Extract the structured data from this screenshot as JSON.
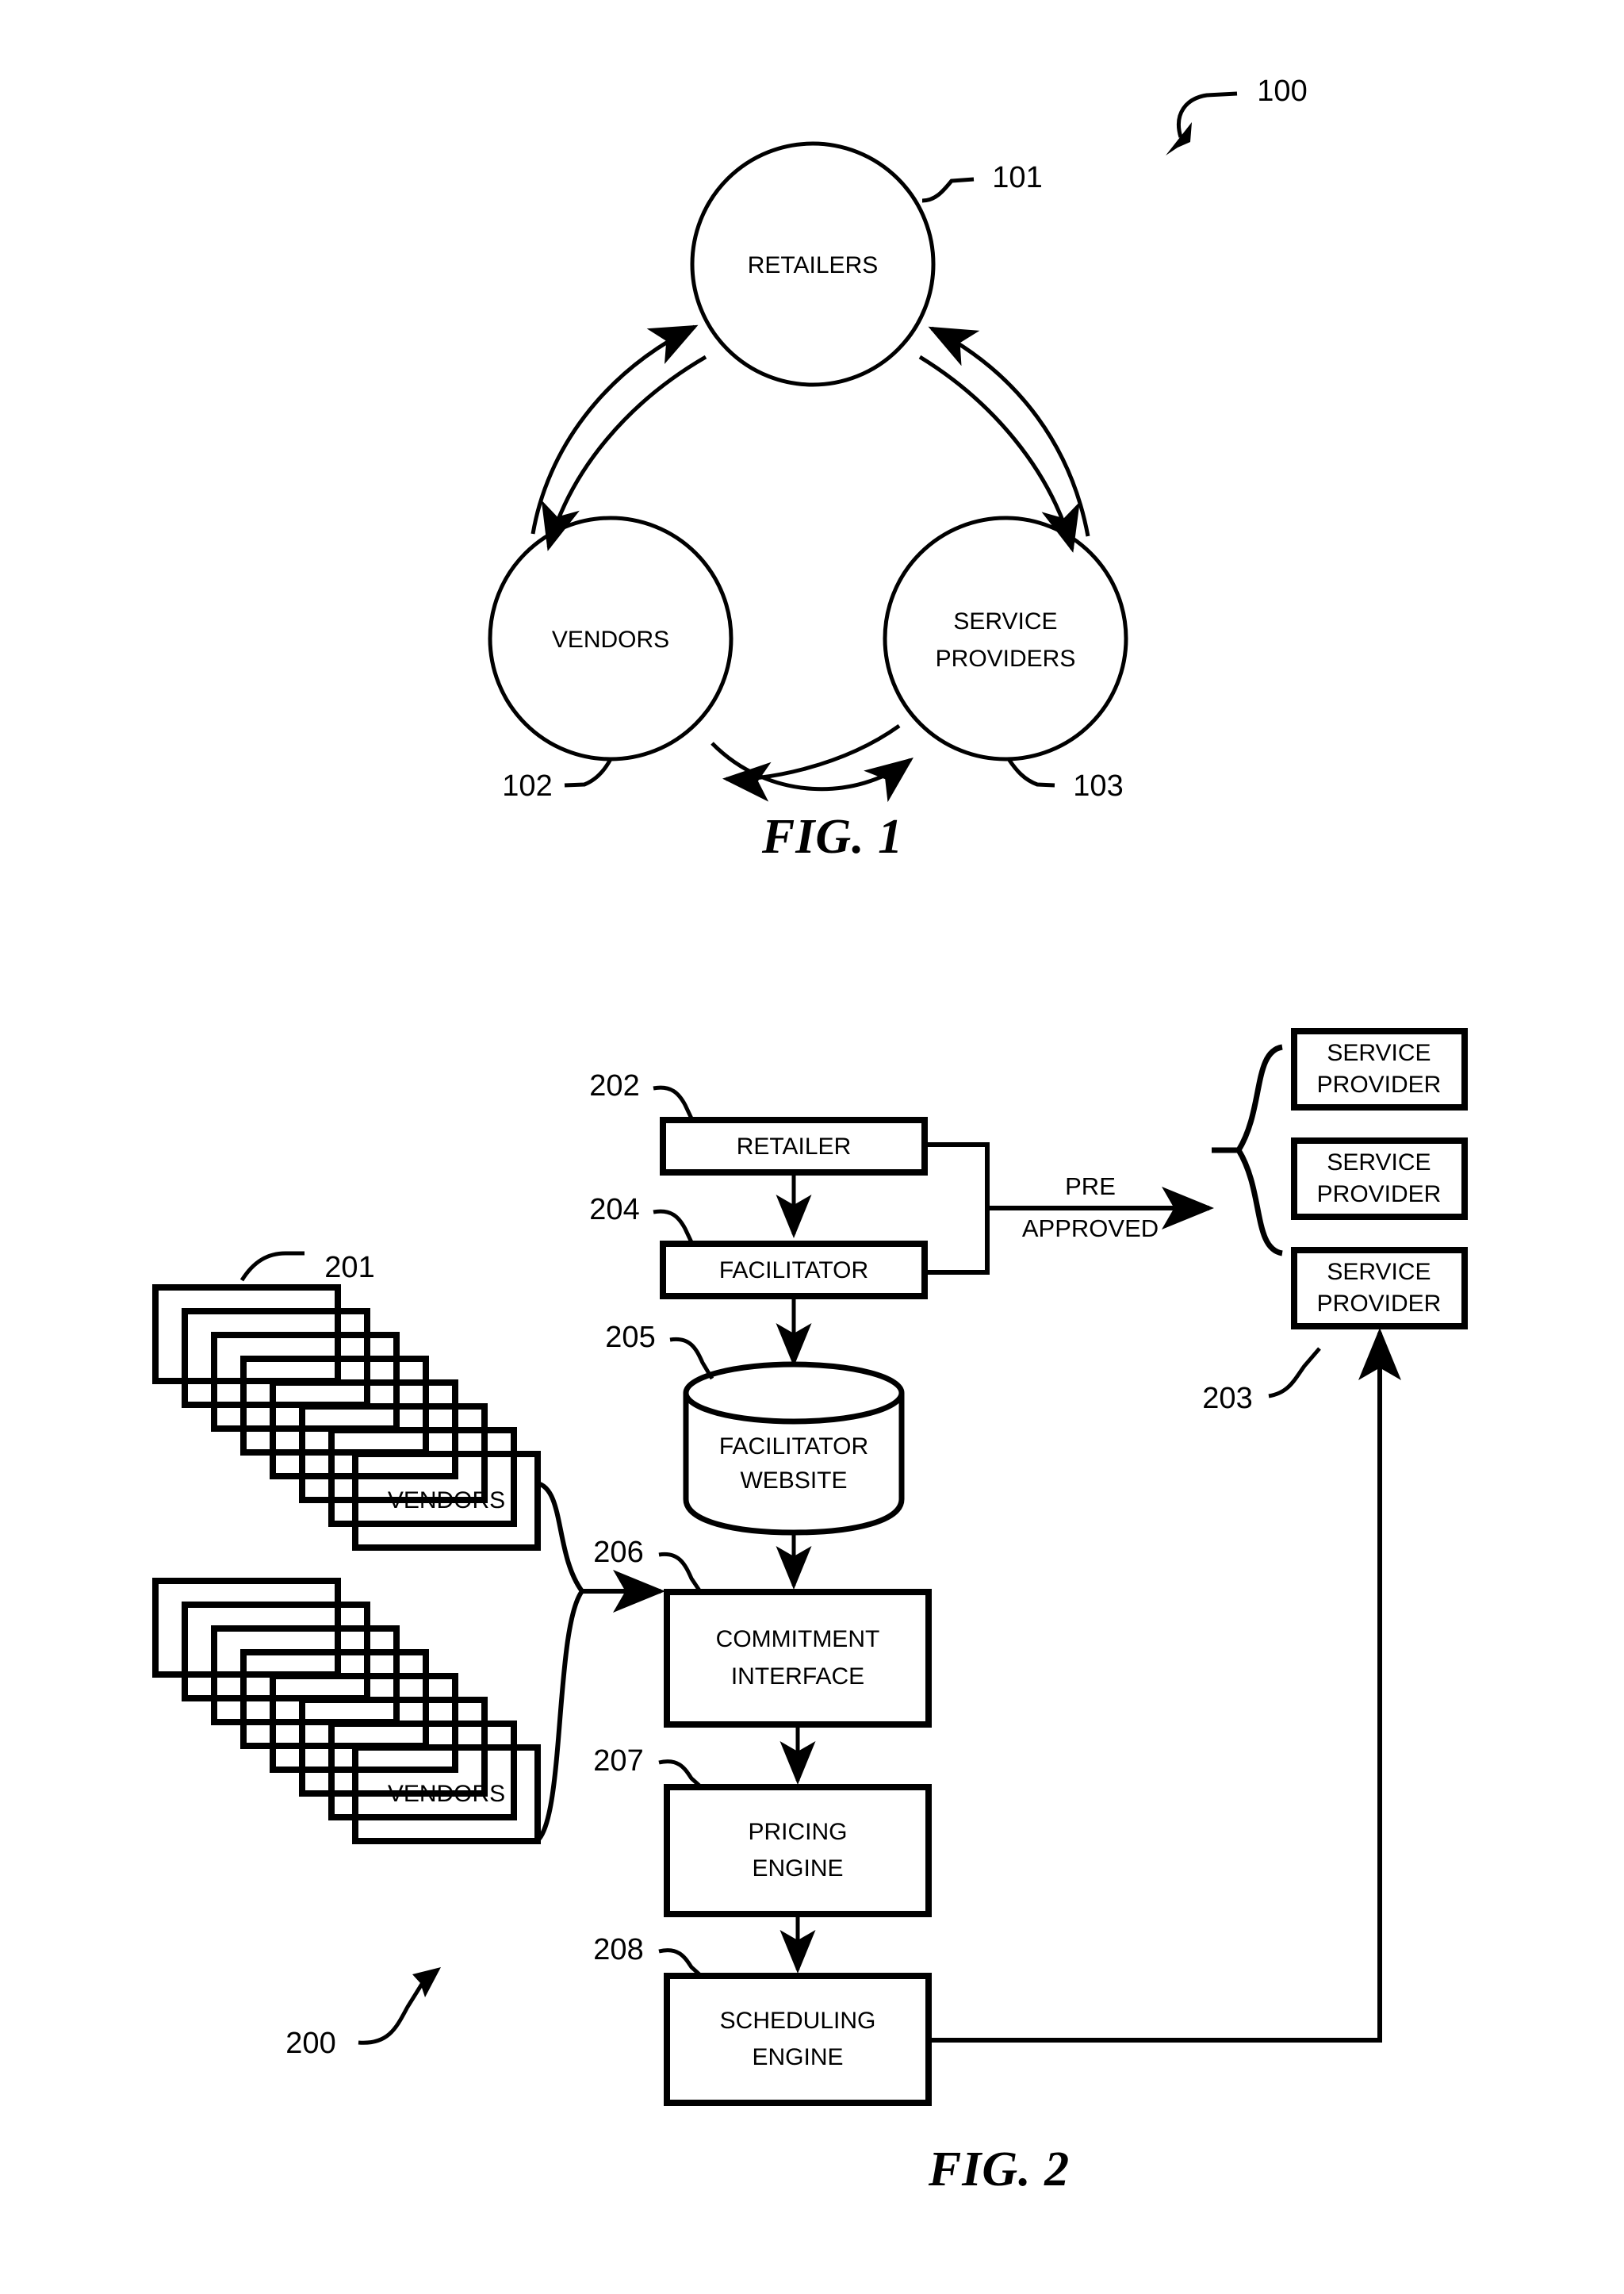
{
  "figures": [
    {
      "id": "fig-1",
      "caption": "FIG. 1",
      "system_ref": "100",
      "nodes": [
        {
          "ref": "101",
          "label": "RETAILERS",
          "lines": [
            "RETAILERS"
          ]
        },
        {
          "ref": "102",
          "label": "VENDORS",
          "lines": [
            "VENDORS"
          ]
        },
        {
          "ref": "103",
          "label": "SERVICE PROVIDERS",
          "lines": [
            "SERVICE",
            "PROVIDERS"
          ]
        }
      ]
    },
    {
      "id": "fig-2",
      "caption": "FIG. 2",
      "system_ref": "200",
      "nodes": [
        {
          "ref": "202",
          "label": "RETAILER",
          "lines": [
            "RETAILER"
          ],
          "shape": "box"
        },
        {
          "ref": "204",
          "label": "FACILITATOR",
          "lines": [
            "FACILITATOR"
          ],
          "shape": "box"
        },
        {
          "ref": "205",
          "label": "FACILITATOR WEBSITE",
          "lines": [
            "FACILITATOR",
            "WEBSITE"
          ],
          "shape": "cylinder"
        },
        {
          "ref": "206",
          "label": "COMMITMENT INTERFACE",
          "lines": [
            "COMMITMENT",
            "INTERFACE"
          ],
          "shape": "box"
        },
        {
          "ref": "207",
          "label": "PRICING ENGINE",
          "lines": [
            "PRICING",
            "ENGINE"
          ],
          "shape": "box"
        },
        {
          "ref": "208",
          "label": "SCHEDULING ENGINE",
          "lines": [
            "SCHEDULING",
            "ENGINE"
          ],
          "shape": "box"
        },
        {
          "ref": "201",
          "label": "VENDORS",
          "lines": [
            "VENDORS"
          ],
          "shape": "card-stack"
        },
        {
          "ref": "203",
          "label": "SERVICE PROVIDER",
          "lines": [
            "SERVICE",
            "PROVIDER"
          ],
          "shape": "box-group"
        }
      ],
      "service_providers": [
        {
          "lines": [
            "SERVICE",
            "PROVIDER"
          ]
        },
        {
          "lines": [
            "SERVICE",
            "PROVIDER"
          ]
        },
        {
          "lines": [
            "SERVICE",
            "PROVIDER"
          ]
        }
      ],
      "vendor_stacks": [
        {
          "ref": "201",
          "label": "VENDORS",
          "card_count": 8
        },
        {
          "ref": "",
          "label": "VENDORS",
          "card_count": 8
        }
      ],
      "edge_labels": [
        {
          "lines": [
            "PRE",
            "APPROVED"
          ]
        }
      ]
    }
  ],
  "refs": {
    "r100": "100",
    "r101": "101",
    "r102": "102",
    "r103": "103",
    "r200": "200",
    "r201": "201",
    "r202": "202",
    "r203": "203",
    "r204": "204",
    "r205": "205",
    "r206": "206",
    "r207": "207",
    "r208": "208"
  },
  "text": {
    "retailers": "RETAILERS",
    "vendors": "VENDORS",
    "service": "SERVICE",
    "providers": "PROVIDERS",
    "provider": "PROVIDER",
    "retailer": "RETAILER",
    "facilitator": "FACILITATOR",
    "website": "WEBSITE",
    "commitment": "COMMITMENT",
    "interface": "INTERFACE",
    "pricing": "PRICING",
    "engine": "ENGINE",
    "scheduling": "SCHEDULING",
    "pre": "PRE",
    "approved": "APPROVED",
    "fig1": "FIG. 1",
    "fig2": "FIG. 2",
    "vendors_a": "VENDORS",
    "vendors_b": "VENDORS",
    "sp1_a": "SERVICE",
    "sp1_b": "PROVIDER",
    "sp2_a": "SERVICE",
    "sp2_b": "PROVIDER",
    "sp3_a": "SERVICE",
    "sp3_b": "PROVIDER"
  },
  "colors": {
    "ink": "#000000",
    "paper": "#ffffff"
  }
}
